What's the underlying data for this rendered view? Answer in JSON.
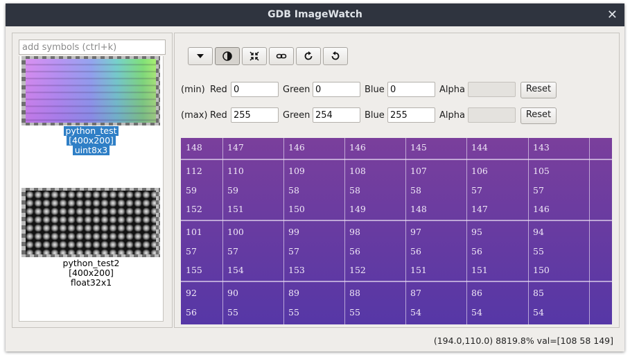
{
  "window": {
    "title": "GDB ImageWatch"
  },
  "symbols": {
    "search_placeholder": "add symbols (ctrl+k)",
    "items": [
      {
        "name": "python_test",
        "size": "[400x200]",
        "type": "uint8x3",
        "selected": true
      },
      {
        "name": "python_test2",
        "size": "[400x200]",
        "type": "float32x1",
        "selected": false
      }
    ]
  },
  "toolbar": {
    "buttons": [
      "dropdown-icon",
      "contrast-icon",
      "shrink-icon",
      "link-icon",
      "rotate-cw-icon",
      "rotate-ccw-icon"
    ]
  },
  "contrast": {
    "min": {
      "label": "(min)",
      "red_label": "Red",
      "red": "0",
      "green_label": "Green",
      "green": "0",
      "blue_label": "Blue",
      "blue": "0",
      "alpha_label": "Alpha",
      "alpha": "",
      "reset": "Reset"
    },
    "max": {
      "label": "(max)",
      "red_label": "Red",
      "red": "255",
      "green_label": "Green",
      "green": "254",
      "blue_label": "Blue",
      "blue": "255",
      "alpha_label": "Alpha",
      "alpha": "",
      "reset": "Reset"
    }
  },
  "pixel_grid": {
    "rows": [
      [
        [
          "148"
        ],
        [
          "147"
        ],
        [
          "146"
        ],
        [
          "146"
        ],
        [
          "145"
        ],
        [
          "144"
        ],
        [
          "143"
        ]
      ],
      [
        [
          "112",
          "59",
          "152"
        ],
        [
          "110",
          "59",
          "151"
        ],
        [
          "109",
          "58",
          "150"
        ],
        [
          "108",
          "58",
          "149"
        ],
        [
          "107",
          "58",
          "148"
        ],
        [
          "106",
          "57",
          "147"
        ],
        [
          "105",
          "57",
          "146"
        ]
      ],
      [
        [
          "101",
          "57",
          "155"
        ],
        [
          "100",
          "57",
          "154"
        ],
        [
          "99",
          "57",
          "153"
        ],
        [
          "98",
          "56",
          "152"
        ],
        [
          "97",
          "56",
          "151"
        ],
        [
          "95",
          "56",
          "151"
        ],
        [
          "94",
          "55",
          "150"
        ]
      ],
      [
        [
          "92",
          "56"
        ],
        [
          "90",
          "55"
        ],
        [
          "89",
          "55"
        ],
        [
          "88",
          "55"
        ],
        [
          "87",
          "54"
        ],
        [
          "86",
          "54"
        ],
        [
          "85",
          "54"
        ]
      ]
    ]
  },
  "status": "(194.0,110.0) 8819.8% val=[108 58 149]"
}
